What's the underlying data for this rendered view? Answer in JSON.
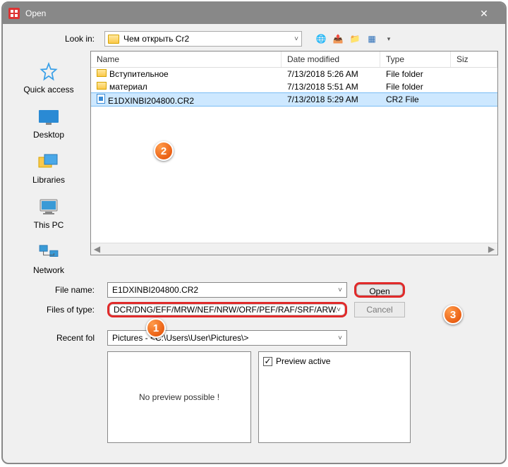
{
  "titlebar": {
    "title": "Open",
    "close": "✕"
  },
  "lookin": {
    "label": "Look in:",
    "value": "Чем открыть Cr2"
  },
  "toolbar_icons": {
    "back": "🌐",
    "up": "📤",
    "new": "📁",
    "view": "▦",
    "view_arrow": "▾"
  },
  "places": {
    "quick": "Quick access",
    "desktop": "Desktop",
    "libraries": "Libraries",
    "thispc": "This PC",
    "network": "Network"
  },
  "columns": {
    "name": "Name",
    "date": "Date modified",
    "type": "Type",
    "size": "Siz"
  },
  "files": [
    {
      "icon": "folder",
      "name": "Вступительное",
      "date": "7/13/2018 5:26 AM",
      "type": "File folder"
    },
    {
      "icon": "folder",
      "name": "материал",
      "date": "7/13/2018 5:51 AM",
      "type": "File folder"
    },
    {
      "icon": "file",
      "name": "E1DXINBI204800.CR2",
      "date": "7/13/2018 5:29 AM",
      "type": "CR2 File",
      "selected": true
    }
  ],
  "form": {
    "filename_label": "File name:",
    "filename_value": "E1DXINBI204800.CR2",
    "filetype_label": "Files of type:",
    "filetype_value": "DCR/DNG/EFF/MRW/NEF/NRW/ORF/PEF/RAF/SRF/ARW/",
    "recent_label": "Recent fol",
    "recent_value": "Pictures  -  <C:\\Users\\User\\Pictures\\>",
    "open": "Open",
    "cancel": "Cancel"
  },
  "preview": {
    "none": "No preview possible !",
    "active_label": "Preview active",
    "checked": "✓"
  },
  "badges": {
    "b1": "1",
    "b2": "2",
    "b3": "3"
  },
  "scroll": {
    "left": "◀",
    "right": "▶"
  }
}
